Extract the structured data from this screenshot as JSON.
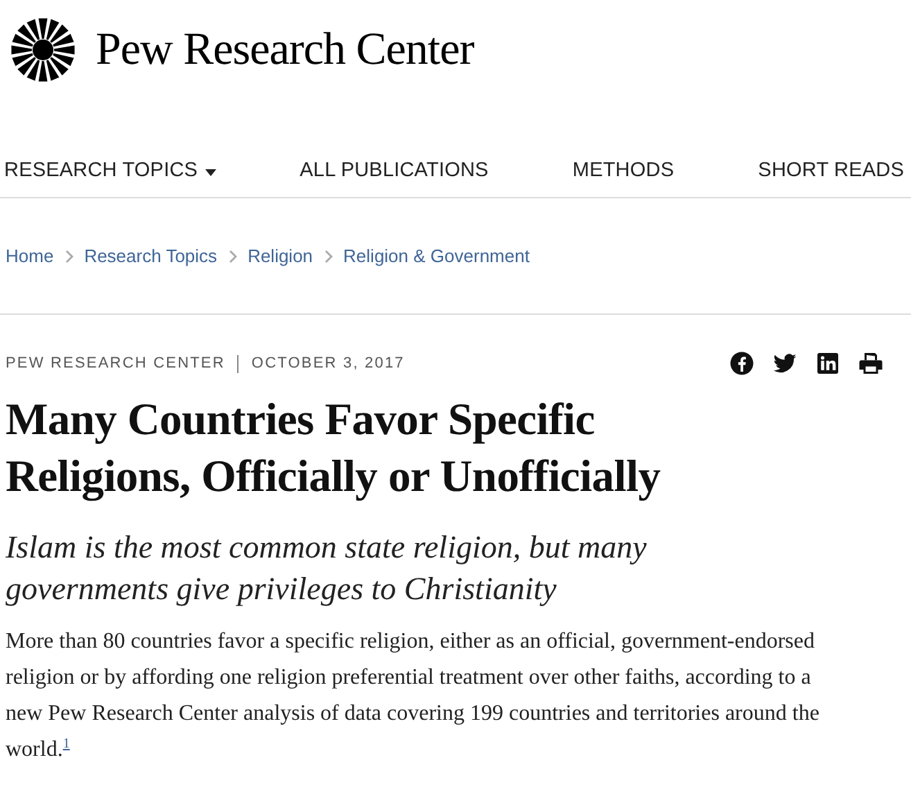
{
  "brand": {
    "name": "Pew Research Center"
  },
  "nav": [
    {
      "label": "RESEARCH TOPICS",
      "has_dropdown": true
    },
    {
      "label": "ALL PUBLICATIONS",
      "has_dropdown": false
    },
    {
      "label": "METHODS",
      "has_dropdown": false
    },
    {
      "label": "SHORT READS",
      "has_dropdown": false
    }
  ],
  "breadcrumb": [
    "Home",
    "Research Topics",
    "Religion",
    "Religion & Government"
  ],
  "meta": {
    "source": "PEW RESEARCH CENTER",
    "date": "OCTOBER 3, 2017"
  },
  "share": [
    {
      "kind": "facebook"
    },
    {
      "kind": "twitter"
    },
    {
      "kind": "linkedin"
    },
    {
      "kind": "print"
    }
  ],
  "title": "Many Countries Favor Specific Religions, Officially or Unofficially",
  "subtitle": "Islam is the most common state religion, but many governments give privileges to Christianity",
  "body": {
    "text": "More than 80 countries favor a specific religion, either as an official, government-endorsed religion or by affording one religion preferential treatment over other faiths, according to a new Pew Research Center analysis of data covering 199 countries and territories around the world.",
    "footnote": "1"
  }
}
